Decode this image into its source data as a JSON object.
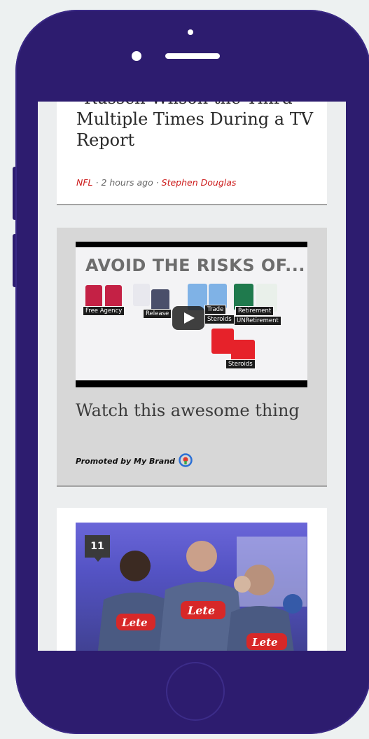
{
  "article": {
    "title": "\"Russell Wilson the Third\" Multiple Times During a TV Report",
    "category": "NFL",
    "separator1": " · ",
    "time": "2 hours ago",
    "separator2": " · ",
    "author": "Stephen Douglas"
  },
  "promo": {
    "video_headline": "AVOID THE RISKS OF...",
    "video_tags": [
      "Free Agency",
      "Release",
      "Trade",
      "Steroids",
      "Retirement",
      "UNRetirement",
      "Steroids"
    ],
    "title": "Watch this awesome thing",
    "promoted_by": "Promoted by My Brand"
  },
  "gallery": {
    "photo_count": "11",
    "shirt_text": "Lete"
  },
  "colors": {
    "phone_body": "#2d1c6f",
    "accent_red": "#cc1a1a"
  }
}
